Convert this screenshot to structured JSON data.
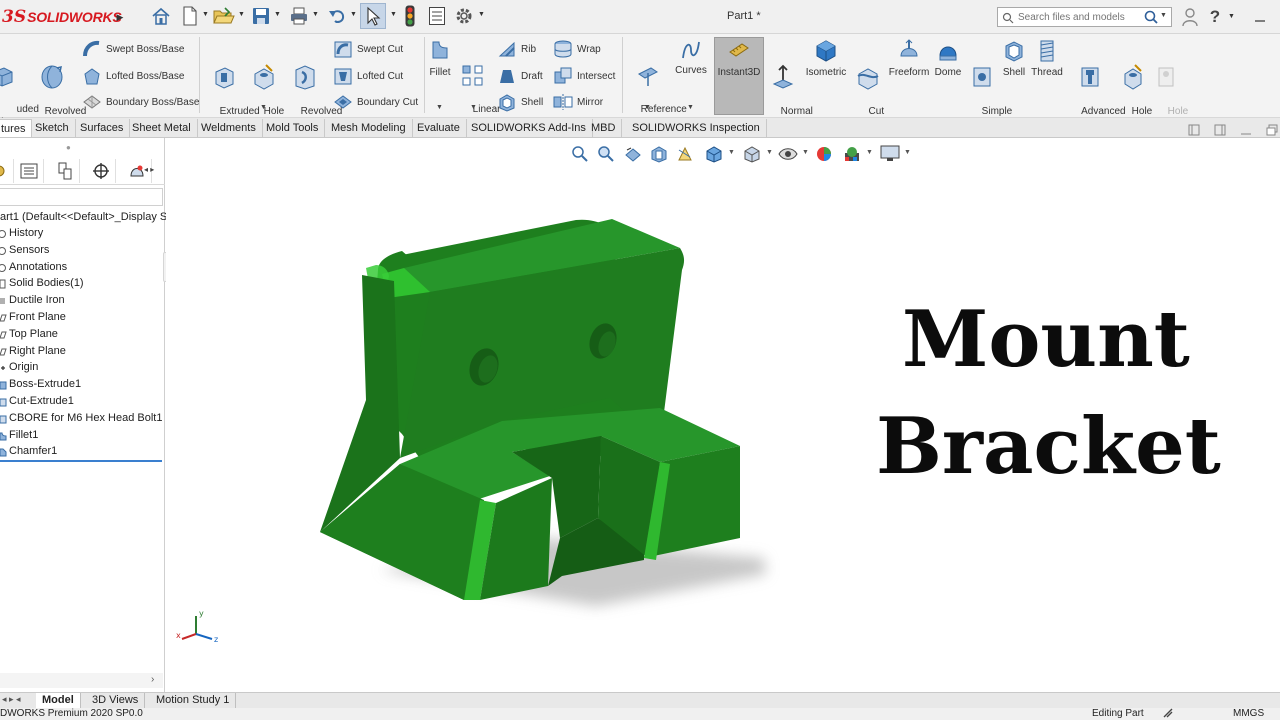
{
  "app": {
    "brand_prefix": "3S",
    "brand": "SOLIDWORKS",
    "document_title": "Part1 *"
  },
  "search": {
    "placeholder": "Search files and models"
  },
  "colors": {
    "model_green": "#1f8a1f",
    "brand_red": "#d71920",
    "accent_blue": "#3a7fcf"
  },
  "commands": {
    "extruded_boss": "uded\n/Base",
    "revolved_boss": "Revolved\nBoss/Base",
    "swept_boss": "Swept Boss/Base",
    "lofted_boss": "Lofted Boss/Base",
    "boundary_boss": "Boundary Boss/Base",
    "extruded_cut": "Extruded\nCut",
    "hole_wizard": "Hole\nWizard",
    "revolved_cut": "Revolved\nCut",
    "swept_cut": "Swept Cut",
    "lofted_cut": "Lofted Cut",
    "boundary_cut": "Boundary Cut",
    "fillet": "Fillet",
    "linear_pattern": "Linear\nPattern",
    "rib": "Rib",
    "draft": "Draft",
    "shell": "Shell",
    "wrap": "Wrap",
    "intersect": "Intersect",
    "mirror": "Mirror",
    "reference_geometry": "Reference\nGeometry",
    "curves": "Curves",
    "instant3d": "Instant3D",
    "normal_to": "Normal\nTo",
    "isometric": "Isometric",
    "cut_with_surface": "Cut\nWith\nSurface",
    "freeform": "Freeform",
    "dome": "Dome",
    "simple_hole": "Simple\nHole",
    "shell2": "Shell",
    "thread": "Thread",
    "advanced_hole": "Advanced\nHole",
    "hole_wizard2": "Hole\nWizard",
    "hole_series": "Hole\nSeries"
  },
  "tabs": [
    "tures",
    "Sketch",
    "Surfaces",
    "Sheet Metal",
    "Weldments",
    "Mold Tools",
    "Mesh Modeling",
    "Evaluate",
    "SOLIDWORKS Add-Ins",
    "MBD",
    "SOLIDWORKS Inspection"
  ],
  "feature_tree": {
    "root": "art1  (Default<<Default>_Display S",
    "items": [
      "History",
      "Sensors",
      "Annotations",
      "Solid Bodies(1)",
      "Ductile Iron",
      "Front Plane",
      "Top Plane",
      "Right Plane",
      "Origin",
      "Boss-Extrude1",
      "Cut-Extrude1",
      "CBORE for M6 Hex Head Bolt1",
      "Fillet1",
      "Chamfer1"
    ]
  },
  "overlay_title": {
    "line1": "Mount",
    "line2": "Bracket"
  },
  "triad": {
    "x": "x",
    "y": "y",
    "z": "z"
  },
  "bottom_tabs": [
    "Model",
    "3D Views",
    "Motion Study 1"
  ],
  "status": {
    "left": "DWORKS Premium 2020 SP0.0",
    "mode": "Editing Part",
    "units": "MMGS"
  }
}
